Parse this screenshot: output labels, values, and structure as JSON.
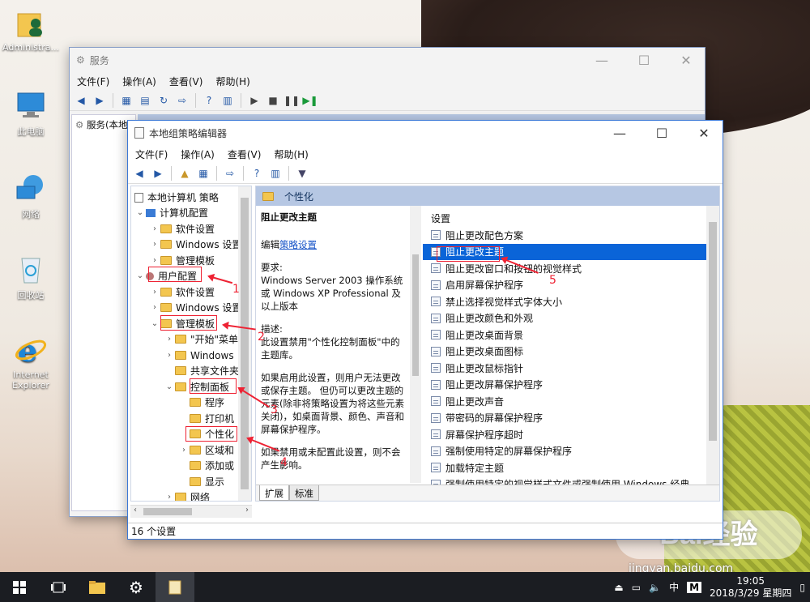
{
  "desktop_icons": [
    {
      "label": "Administra...",
      "icon": "user-folder-icon"
    },
    {
      "label": "此电脑",
      "icon": "computer-icon"
    },
    {
      "label": "网络",
      "icon": "network-icon"
    },
    {
      "label": "回收站",
      "icon": "recycle-bin-icon"
    },
    {
      "label": "Internet Explorer",
      "icon": "ie-icon"
    }
  ],
  "services_window": {
    "title": "服务",
    "menu": [
      "文件(F)",
      "操作(A)",
      "查看(V)",
      "帮助(H)"
    ],
    "tree_item": "服务(本地)"
  },
  "gpedit_window": {
    "title": "本地组策略编辑器",
    "menu": [
      "文件(F)",
      "操作(A)",
      "查看(V)",
      "帮助(H)"
    ],
    "tree": {
      "root": "本地计算机 策略",
      "computer_config": "计算机配置",
      "cc_children": [
        "软件设置",
        "Windows 设置",
        "管理模板"
      ],
      "user_config": "用户配置",
      "uc_children": [
        "软件设置",
        "Windows 设置",
        "管理模板"
      ],
      "admin_children": [
        "\"开始\"菜单",
        "Windows",
        "共享文件夹",
        "控制面板"
      ],
      "control_panel_children": [
        "程序",
        "打印机",
        "个性化",
        "区域和",
        "添加或",
        "显示"
      ],
      "network": "网络"
    },
    "right_header": "个性化",
    "desc": {
      "title": "阻止更改主题",
      "edit_prefix": "编辑",
      "edit_link": "策略设置",
      "req_label": "要求:",
      "req_text": "Windows Server 2003 操作系统或 Windows XP Professional 及以上版本",
      "desc_label": "描述:",
      "desc_text": "此设置禁用\"个性化控制面板\"中的主题库。",
      "enabled_text": "如果启用此设置，则用户无法更改或保存主题。 但仍可以更改主题的元素(除非将策略设置为将这些元素关闭)，如桌面背景、颜色、声音和屏幕保护程序。",
      "disabled_text": "如果禁用或未配置此设置，则不会产生影响。"
    },
    "list_header": "设置",
    "settings": [
      "阻止更改配色方案",
      "阻止更改主题",
      "阻止更改窗口和按钮的视觉样式",
      "启用屏幕保护程序",
      "禁止选择视觉样式字体大小",
      "阻止更改颜色和外观",
      "阻止更改桌面背景",
      "阻止更改桌面图标",
      "阻止更改鼠标指针",
      "阻止更改屏幕保护程序",
      "阻止更改声音",
      "带密码的屏幕保护程序",
      "屏幕保护程序超时",
      "强制使用特定的屏幕保护程序",
      "加载特定主题",
      "强制使用特定的视觉样式文件或强制使用 Windows 经典"
    ],
    "selected_index": 1,
    "tabs": [
      "扩展",
      "标准"
    ],
    "status": "16 个设置"
  },
  "annotations": [
    "1",
    "2",
    "3",
    "4",
    "5"
  ],
  "watermark": {
    "brand": "Bai经验",
    "url": "jingyan.baidu.com"
  },
  "taskbar": {
    "ime": "中",
    "ime_mode": "M",
    "time": "19:05",
    "date": "2018/3/29 星期四"
  }
}
